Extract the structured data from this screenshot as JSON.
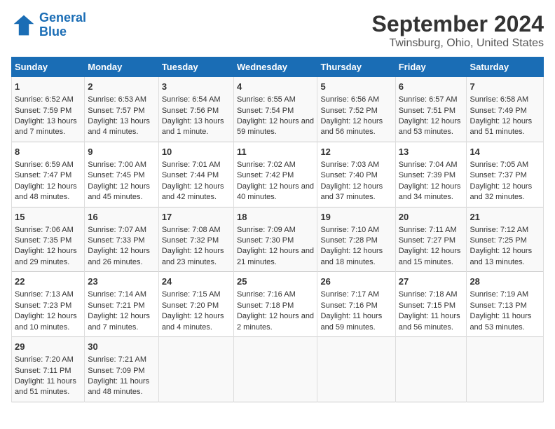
{
  "logo": {
    "line1": "General",
    "line2": "Blue"
  },
  "title": "September 2024",
  "subtitle": "Twinsburg, Ohio, United States",
  "days_of_week": [
    "Sunday",
    "Monday",
    "Tuesday",
    "Wednesday",
    "Thursday",
    "Friday",
    "Saturday"
  ],
  "weeks": [
    [
      {
        "day": "1",
        "sunrise": "Sunrise: 6:52 AM",
        "sunset": "Sunset: 7:59 PM",
        "daylight": "Daylight: 13 hours and 7 minutes."
      },
      {
        "day": "2",
        "sunrise": "Sunrise: 6:53 AM",
        "sunset": "Sunset: 7:57 PM",
        "daylight": "Daylight: 13 hours and 4 minutes."
      },
      {
        "day": "3",
        "sunrise": "Sunrise: 6:54 AM",
        "sunset": "Sunset: 7:56 PM",
        "daylight": "Daylight: 13 hours and 1 minute."
      },
      {
        "day": "4",
        "sunrise": "Sunrise: 6:55 AM",
        "sunset": "Sunset: 7:54 PM",
        "daylight": "Daylight: 12 hours and 59 minutes."
      },
      {
        "day": "5",
        "sunrise": "Sunrise: 6:56 AM",
        "sunset": "Sunset: 7:52 PM",
        "daylight": "Daylight: 12 hours and 56 minutes."
      },
      {
        "day": "6",
        "sunrise": "Sunrise: 6:57 AM",
        "sunset": "Sunset: 7:51 PM",
        "daylight": "Daylight: 12 hours and 53 minutes."
      },
      {
        "day": "7",
        "sunrise": "Sunrise: 6:58 AM",
        "sunset": "Sunset: 7:49 PM",
        "daylight": "Daylight: 12 hours and 51 minutes."
      }
    ],
    [
      {
        "day": "8",
        "sunrise": "Sunrise: 6:59 AM",
        "sunset": "Sunset: 7:47 PM",
        "daylight": "Daylight: 12 hours and 48 minutes."
      },
      {
        "day": "9",
        "sunrise": "Sunrise: 7:00 AM",
        "sunset": "Sunset: 7:45 PM",
        "daylight": "Daylight: 12 hours and 45 minutes."
      },
      {
        "day": "10",
        "sunrise": "Sunrise: 7:01 AM",
        "sunset": "Sunset: 7:44 PM",
        "daylight": "Daylight: 12 hours and 42 minutes."
      },
      {
        "day": "11",
        "sunrise": "Sunrise: 7:02 AM",
        "sunset": "Sunset: 7:42 PM",
        "daylight": "Daylight: 12 hours and 40 minutes."
      },
      {
        "day": "12",
        "sunrise": "Sunrise: 7:03 AM",
        "sunset": "Sunset: 7:40 PM",
        "daylight": "Daylight: 12 hours and 37 minutes."
      },
      {
        "day": "13",
        "sunrise": "Sunrise: 7:04 AM",
        "sunset": "Sunset: 7:39 PM",
        "daylight": "Daylight: 12 hours and 34 minutes."
      },
      {
        "day": "14",
        "sunrise": "Sunrise: 7:05 AM",
        "sunset": "Sunset: 7:37 PM",
        "daylight": "Daylight: 12 hours and 32 minutes."
      }
    ],
    [
      {
        "day": "15",
        "sunrise": "Sunrise: 7:06 AM",
        "sunset": "Sunset: 7:35 PM",
        "daylight": "Daylight: 12 hours and 29 minutes."
      },
      {
        "day": "16",
        "sunrise": "Sunrise: 7:07 AM",
        "sunset": "Sunset: 7:33 PM",
        "daylight": "Daylight: 12 hours and 26 minutes."
      },
      {
        "day": "17",
        "sunrise": "Sunrise: 7:08 AM",
        "sunset": "Sunset: 7:32 PM",
        "daylight": "Daylight: 12 hours and 23 minutes."
      },
      {
        "day": "18",
        "sunrise": "Sunrise: 7:09 AM",
        "sunset": "Sunset: 7:30 PM",
        "daylight": "Daylight: 12 hours and 21 minutes."
      },
      {
        "day": "19",
        "sunrise": "Sunrise: 7:10 AM",
        "sunset": "Sunset: 7:28 PM",
        "daylight": "Daylight: 12 hours and 18 minutes."
      },
      {
        "day": "20",
        "sunrise": "Sunrise: 7:11 AM",
        "sunset": "Sunset: 7:27 PM",
        "daylight": "Daylight: 12 hours and 15 minutes."
      },
      {
        "day": "21",
        "sunrise": "Sunrise: 7:12 AM",
        "sunset": "Sunset: 7:25 PM",
        "daylight": "Daylight: 12 hours and 13 minutes."
      }
    ],
    [
      {
        "day": "22",
        "sunrise": "Sunrise: 7:13 AM",
        "sunset": "Sunset: 7:23 PM",
        "daylight": "Daylight: 12 hours and 10 minutes."
      },
      {
        "day": "23",
        "sunrise": "Sunrise: 7:14 AM",
        "sunset": "Sunset: 7:21 PM",
        "daylight": "Daylight: 12 hours and 7 minutes."
      },
      {
        "day": "24",
        "sunrise": "Sunrise: 7:15 AM",
        "sunset": "Sunset: 7:20 PM",
        "daylight": "Daylight: 12 hours and 4 minutes."
      },
      {
        "day": "25",
        "sunrise": "Sunrise: 7:16 AM",
        "sunset": "Sunset: 7:18 PM",
        "daylight": "Daylight: 12 hours and 2 minutes."
      },
      {
        "day": "26",
        "sunrise": "Sunrise: 7:17 AM",
        "sunset": "Sunset: 7:16 PM",
        "daylight": "Daylight: 11 hours and 59 minutes."
      },
      {
        "day": "27",
        "sunrise": "Sunrise: 7:18 AM",
        "sunset": "Sunset: 7:15 PM",
        "daylight": "Daylight: 11 hours and 56 minutes."
      },
      {
        "day": "28",
        "sunrise": "Sunrise: 7:19 AM",
        "sunset": "Sunset: 7:13 PM",
        "daylight": "Daylight: 11 hours and 53 minutes."
      }
    ],
    [
      {
        "day": "29",
        "sunrise": "Sunrise: 7:20 AM",
        "sunset": "Sunset: 7:11 PM",
        "daylight": "Daylight: 11 hours and 51 minutes."
      },
      {
        "day": "30",
        "sunrise": "Sunrise: 7:21 AM",
        "sunset": "Sunset: 7:09 PM",
        "daylight": "Daylight: 11 hours and 48 minutes."
      },
      null,
      null,
      null,
      null,
      null
    ]
  ]
}
